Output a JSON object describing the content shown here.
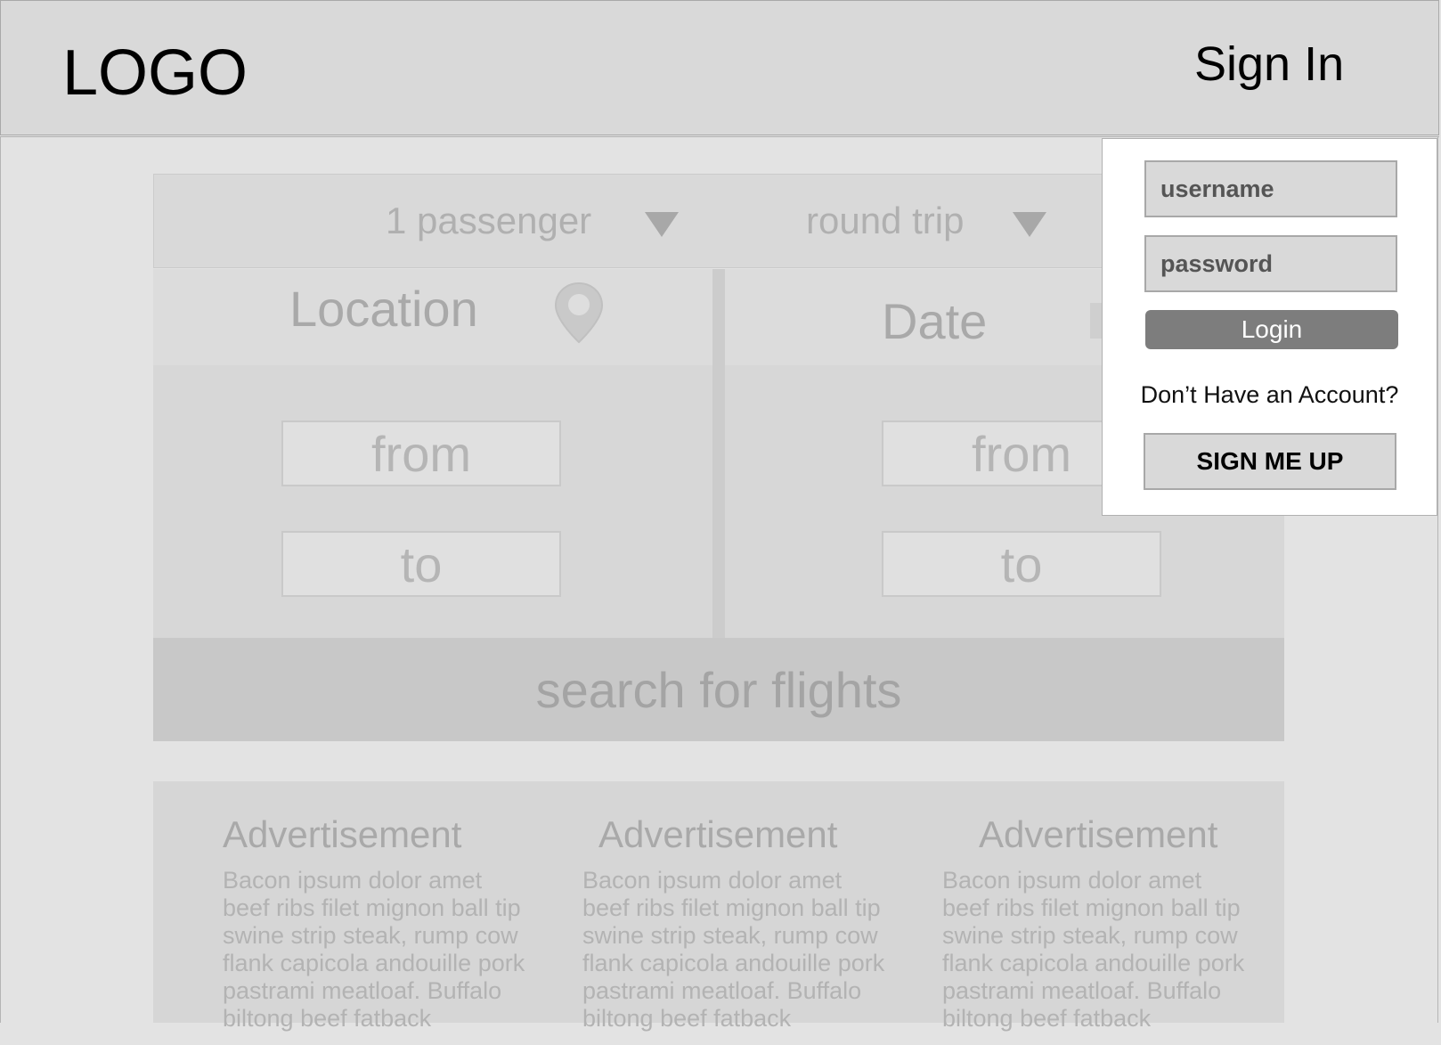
{
  "header": {
    "logo": "LOGO",
    "sign_in": "Sign In"
  },
  "search": {
    "passengers": "1 passenger",
    "trip_type": "round trip",
    "location": {
      "title": "Location",
      "from": "from",
      "to": "to"
    },
    "date": {
      "title": "Date",
      "from": "from",
      "to": "to"
    },
    "submit": "search for flights"
  },
  "ads": [
    {
      "title": "Advertisement",
      "body": "Bacon ipsum dolor amet\nbeef ribs filet mignon ball tip\nswine strip steak, rump cow\nflank capicola andouille pork\npastrami meatloaf. Buffalo\nbiltong beef fatback"
    },
    {
      "title": "Advertisement",
      "body": "Bacon ipsum dolor amet\nbeef ribs filet mignon ball tip\nswine strip steak, rump cow\nflank capicola andouille pork\npastrami meatloaf. Buffalo\nbiltong beef fatback"
    },
    {
      "title": "Advertisement",
      "body": "Bacon ipsum dolor amet\nbeef ribs filet mignon ball tip\nswine strip steak, rump cow\nflank capicola andouille pork\npastrami meatloaf. Buffalo\nbiltong beef fatback"
    }
  ],
  "login_popup": {
    "username_placeholder": "username",
    "password_placeholder": "password",
    "login": "Login",
    "no_account": "Don’t Have an Account?",
    "sign_up": "SIGN ME UP"
  },
  "icons": {
    "location": "map-pin-icon",
    "date": "calendar-icon",
    "dropdown": "triangle-down-icon"
  }
}
